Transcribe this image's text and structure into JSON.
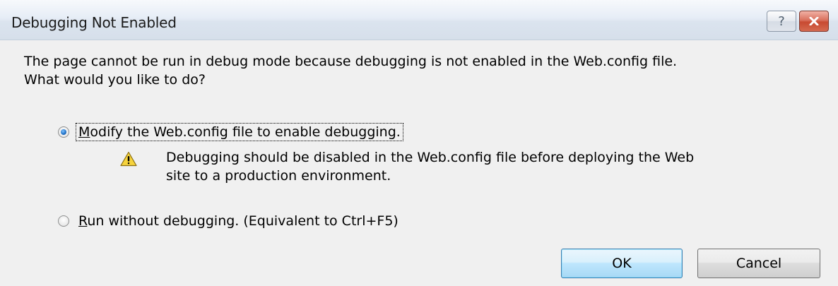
{
  "window": {
    "title": "Debugging Not Enabled",
    "help_glyph": "?",
    "close_glyph": "x"
  },
  "message": {
    "line1": "The page cannot be run in debug mode because debugging is not enabled in the Web.config file.",
    "line2": "What would you like to do?"
  },
  "options": [
    {
      "mnemonic": "M",
      "rest": "odify the Web.config file to enable debugging.",
      "selected": true
    },
    {
      "mnemonic": "R",
      "rest": "un without debugging. (Equivalent to Ctrl+F5)",
      "selected": false
    }
  ],
  "warning": {
    "icon": "warning-icon",
    "line1": "Debugging should be disabled in the Web.config file before deploying the Web",
    "line2": "site to a production environment."
  },
  "buttons": {
    "ok_label": "OK",
    "cancel_label": "Cancel"
  },
  "colors": {
    "close_button": "#c84a31",
    "ok_button_border": "#3c7fb1",
    "warning_yellow": "#f6d33c"
  }
}
